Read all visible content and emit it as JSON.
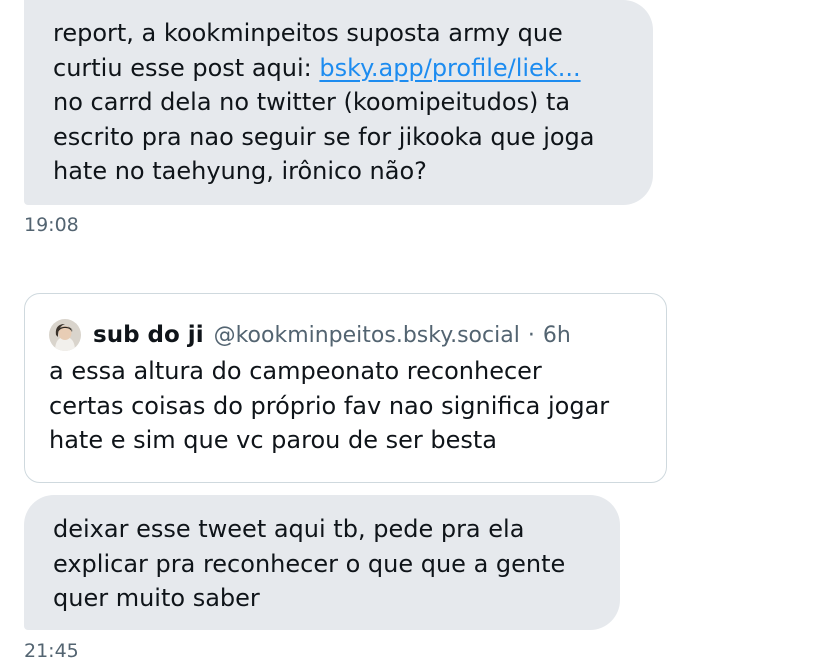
{
  "messages": [
    {
      "lines": [
        "report, a kookminpeitos suposta army que",
        "curtiu esse post aqui: ",
        "no carrd dela no twitter (koomipeitudos) ta",
        "escrito pra nao seguir se for jikooka que joga",
        "hate no taehyung, irônico não?"
      ],
      "link": "bsky.app/profile/liek...",
      "time": "19:08"
    },
    {
      "lines": [
        "deixar esse tweet aqui tb, pede pra ela",
        "explicar pra reconhecer o que que a gente",
        "quer muito saber"
      ],
      "time": "21:45"
    }
  ],
  "quote": {
    "name": "sub do ji",
    "handle": "@kookminpeitos.bsky.social",
    "separator": "·",
    "time": "6h",
    "lines": [
      "a essa altura do campeonato reconhecer",
      "certas coisas do próprio fav nao significa jogar",
      "hate e sim que vc parou de ser besta"
    ]
  },
  "colors": {
    "bubble": "#e6e9ed",
    "link": "#1d8cf0",
    "muted": "#536471",
    "border": "#cfd9de"
  }
}
